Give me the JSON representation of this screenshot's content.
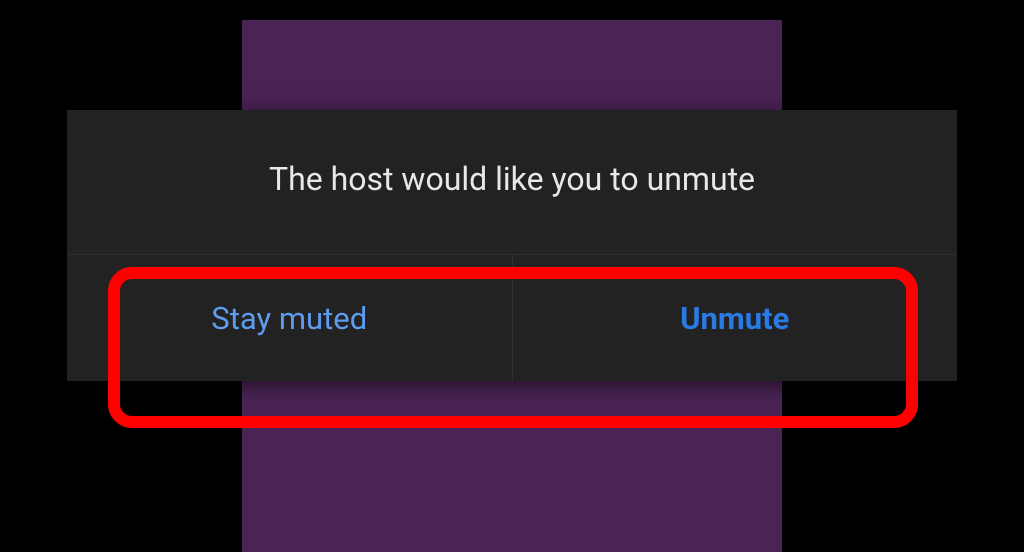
{
  "dialog": {
    "title": "The host would like you to unmute",
    "buttons": {
      "stay_muted": "Stay muted",
      "unmute": "Unmute"
    }
  },
  "colors": {
    "background": "#000000",
    "tile": "#4b2456",
    "dialog_bg": "#222222",
    "text": "#e8e8e8",
    "link_blue": "#5e9cf0",
    "bold_blue": "#2a7ae4",
    "highlight": "#ff0000"
  }
}
